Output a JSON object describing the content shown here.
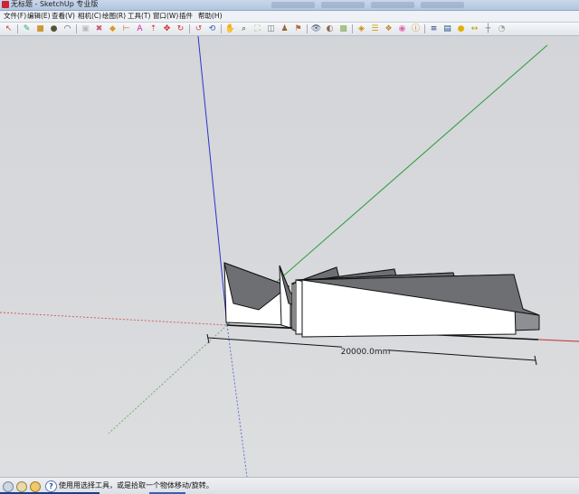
{
  "window": {
    "title": "无标题 - SketchUp 专业版"
  },
  "menu": [
    "文件(F)",
    "编辑(E)",
    "查看(V)",
    "相机(C)",
    "绘图(R)",
    "工具(T)",
    "窗口(W)",
    "插件",
    "帮助(H)"
  ],
  "toolbar": [
    "select-icon",
    "pencil-icon",
    "rectangle-icon",
    "circle-icon",
    "arc-icon",
    "make-component-icon",
    "eraser-icon",
    "paint-bucket-icon",
    "tape-measure-icon",
    "text-icon",
    "push-pull-icon",
    "move-icon",
    "rotate-icon",
    "follow-me-icon",
    "orbit-icon",
    "pan-icon",
    "zoom-icon",
    "zoom-extents-icon",
    "section-icon",
    "walk-icon",
    "position-camera-icon",
    "look-around-icon",
    "shadows-icon",
    "fog-icon",
    "styles-icon",
    "layers-icon",
    "components-icon",
    "materials-icon",
    "entity-info-icon",
    "outliner-icon",
    "scenes-icon",
    "sun-icon",
    "dimension-icon",
    "axes-icon",
    "protractor-icon"
  ],
  "canvas": {
    "dimension_label": "20000.0mm",
    "pillar_count": 6
  },
  "status": {
    "message": "使用用选择工具，或是拾取一个物体移动/旋转。"
  }
}
